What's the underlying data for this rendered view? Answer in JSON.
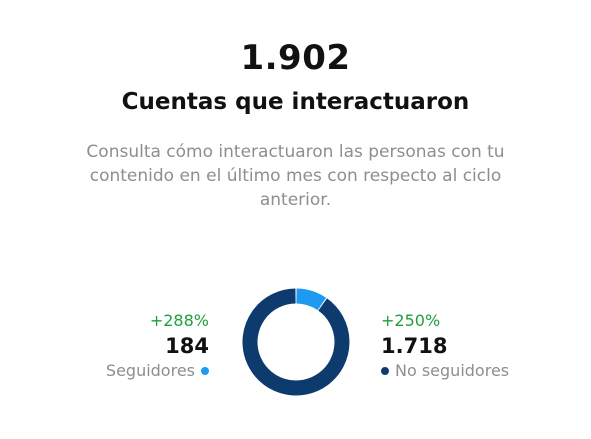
{
  "summary": {
    "total": "1.902",
    "title": "Cuentas que interactuaron",
    "description": "Consulta cómo interactuaron las personas con tu contenido en el último mes con respecto al ciclo anterior."
  },
  "colors": {
    "followers": "#1e9bf0",
    "non_followers": "#0d3b6e",
    "positive_change": "#1f9e3c",
    "muted_text": "#8e8e8e"
  },
  "segments": {
    "followers": {
      "change": "+288%",
      "count": "184",
      "label": "Seguidores"
    },
    "non_followers": {
      "change": "+250%",
      "count": "1.718",
      "label": "No seguidores"
    }
  },
  "chart_data": {
    "type": "pie",
    "categories": [
      "Seguidores",
      "No seguidores"
    ],
    "values": [
      184,
      1718
    ]
  }
}
